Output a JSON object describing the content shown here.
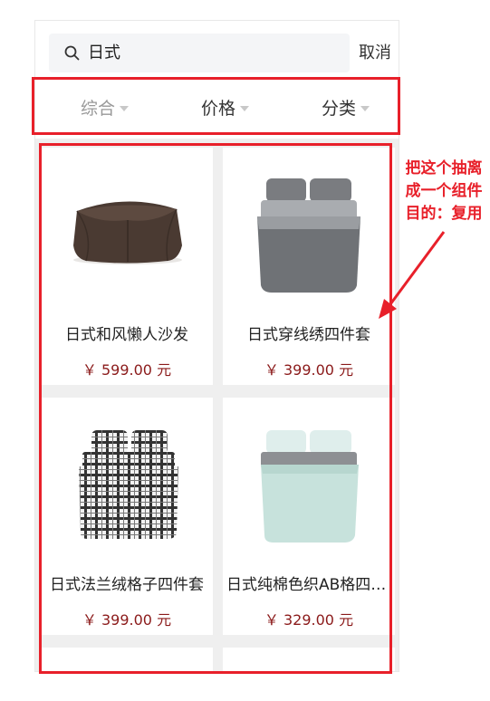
{
  "search": {
    "query": "日式",
    "cancel_label": "取消"
  },
  "sort_tabs": [
    {
      "label": "综合"
    },
    {
      "label": "价格"
    },
    {
      "label": "分类"
    }
  ],
  "products": [
    {
      "name": "日式和风懒人沙发",
      "price": "￥ 599.00 元"
    },
    {
      "name": "日式穿线绣四件套",
      "price": "￥ 399.00 元"
    },
    {
      "name": "日式法兰绒格子四件套",
      "price": "￥ 399.00 元"
    },
    {
      "name": "日式纯棉色织AB格四件套",
      "price": "￥ 329.00 元"
    }
  ],
  "annotation": {
    "line1": "把这个抽离",
    "line2": "成一个组件",
    "line3": "目的：复用",
    "color": "#e8202a"
  },
  "colors": {
    "price": "#8b1a1a",
    "accent": "#e8202a",
    "grid_bg": "#efefef"
  }
}
